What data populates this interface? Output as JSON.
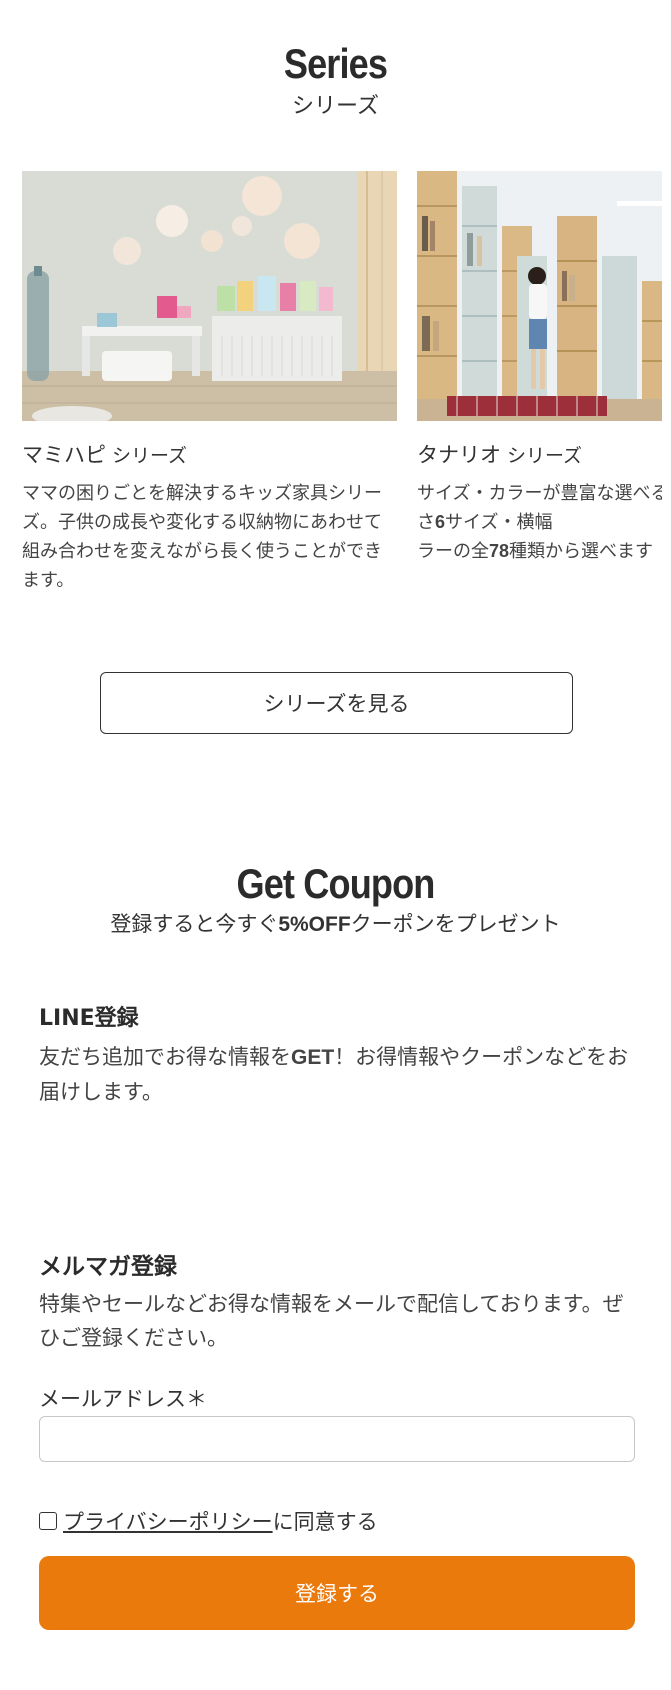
{
  "series": {
    "title": "Series",
    "subtitle": "シリーズ",
    "cards": [
      {
        "name": "マミハピ",
        "suffix": "シリーズ",
        "description": "ママの困りごとを解決するキッズ家具シリーズ。子供の成長や変化する収納物にあわせて組み合わせを変えながら長く使うことができます。"
      },
      {
        "name": "タナリオ",
        "suffix": "シリーズ",
        "desc_parts": [
          "サイズ・カラーが豊富な選べるシリーズ。高さ",
          "6",
          "サイズ・横幅",
          "ラーの全",
          "78",
          "種類から選べます"
        ]
      }
    ],
    "button_label": "シリーズを見る"
  },
  "coupon": {
    "title": "Get Coupon",
    "subtitle_pre": "登録すると今すぐ",
    "subtitle_bold": "5%OFF",
    "subtitle_post": "クーポンをプレゼント"
  },
  "line": {
    "title": "LINE登録",
    "text_pre": "友だち追加でお得な情報を",
    "text_bold": "GET",
    "text_post": "！お得情報やクーポンなどをお届けします。"
  },
  "mail": {
    "title": "メルマガ登録",
    "text": "特集やセールなどお得な情報をメールで配信しております。ぜひご登録ください。",
    "email_label": "メールアドレス＊",
    "email_value": "",
    "consent_link": "プライバシーポリシー",
    "consent_text": "に同意する",
    "submit_label": "登録する"
  },
  "colors": {
    "accent": "#eb7a0c",
    "text": "#333333"
  }
}
